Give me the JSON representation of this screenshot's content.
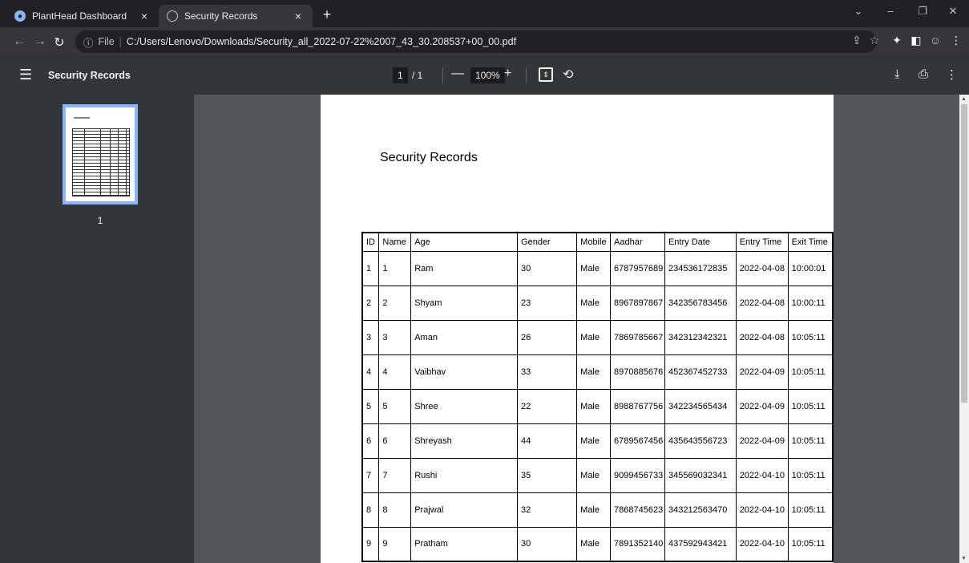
{
  "tabs": [
    {
      "title": "PlantHead Dashboard",
      "close": "×"
    },
    {
      "title": "Security Records",
      "close": "×"
    }
  ],
  "new_tab": "+",
  "window_controls": {
    "dropdown": "⌄",
    "minimize": "–",
    "restore": "❐",
    "close": "✕"
  },
  "address": {
    "info_icon": "ⓘ",
    "scheme": "File",
    "url": "C:/Users/Lenovo/Downloads/Security_all_2022-07-22%2007_43_30.208537+00_00.pdf"
  },
  "pdf_toolbar": {
    "title": "Security Records",
    "current_page": "1",
    "total_pages": "/ 1",
    "zoom": "100%",
    "zoom_out": "—",
    "zoom_in": "+"
  },
  "thumbnails": [
    {
      "page_label": "1"
    }
  ],
  "document": {
    "title": "Security Records",
    "table": {
      "headers": [
        "ID",
        "Name",
        "Age",
        "Gender",
        "Mobile",
        "Aadhar",
        "Entry Date",
        "Entry Time",
        "Exit Time"
      ],
      "rows": [
        [
          "1",
          "1",
          "Ram",
          "30",
          "Male",
          "6787957689",
          "234536172835",
          "2022-04-08",
          "10:00:01"
        ],
        [
          "2",
          "2",
          "Shyam",
          "23",
          "Male",
          "8967897867",
          "342356783456",
          "2022-04-08",
          "10:00:11"
        ],
        [
          "3",
          "3",
          "Aman",
          "26",
          "Male",
          "7869785667",
          "342312342321",
          "2022-04-08",
          "10:05:11"
        ],
        [
          "4",
          "4",
          "Vaibhav",
          "33",
          "Male",
          "8970885676",
          "452367452733",
          "2022-04-09",
          "10:05:11"
        ],
        [
          "5",
          "5",
          "Shree",
          "22",
          "Male",
          "8988767756",
          "342234565434",
          "2022-04-09",
          "10:05:11"
        ],
        [
          "6",
          "6",
          "Shreyash",
          "44",
          "Male",
          "6789567456",
          "435643556723",
          "2022-04-09",
          "10:05:11"
        ],
        [
          "7",
          "7",
          "Rushi",
          "35",
          "Male",
          "9099456733",
          "345569032341",
          "2022-04-10",
          "10:05:11"
        ],
        [
          "8",
          "8",
          "Prajwal",
          "32",
          "Male",
          "7868745623",
          "343212563470",
          "2022-04-10",
          "10:05:11"
        ],
        [
          "9",
          "9",
          "Pratham",
          "30",
          "Male",
          "7891352140",
          "437592943421",
          "2022-04-10",
          "10:05:11"
        ]
      ]
    }
  },
  "colors": {
    "accent": "#8ab4f8",
    "toolbar_bg": "#323639",
    "viewer_bg": "#525659"
  }
}
